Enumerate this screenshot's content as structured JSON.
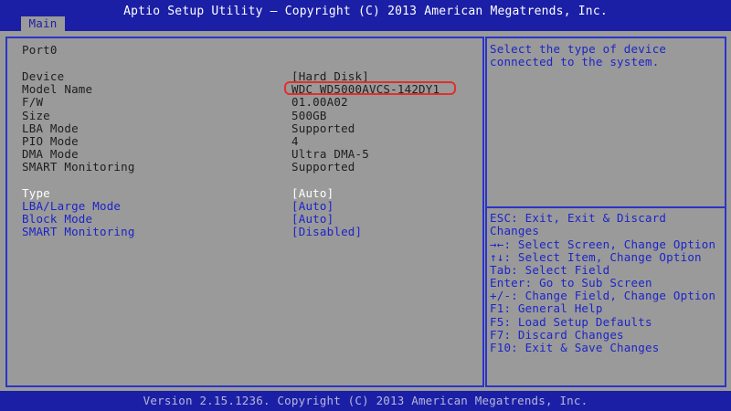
{
  "header": {
    "title": "Aptio Setup Utility – Copyright (C) 2013 American Megatrends, Inc.",
    "tab": "Main"
  },
  "main": {
    "port": "Port0",
    "info": [
      {
        "label": "Device",
        "value": "[Hard Disk]"
      },
      {
        "label": "Model Name",
        "value": "WDC WD5000AVCS-142DY1"
      },
      {
        "label": "F/W",
        "value": "01.00A02"
      },
      {
        "label": "Size",
        "value": "500GB"
      },
      {
        "label": "LBA Mode",
        "value": "Supported"
      },
      {
        "label": "PIO Mode",
        "value": "4"
      },
      {
        "label": "DMA Mode",
        "value": "Ultra DMA-5"
      },
      {
        "label": "SMART Monitoring",
        "value": "Supported"
      }
    ],
    "settings": [
      {
        "label": "Type",
        "value": "[Auto]"
      },
      {
        "label": "LBA/Large Mode",
        "value": "[Auto]"
      },
      {
        "label": "Block Mode",
        "value": "[Auto]"
      },
      {
        "label": "SMART Monitoring",
        "value": "[Disabled]"
      }
    ]
  },
  "help": {
    "description_lines": [
      "Select the type of device",
      "connected to the system."
    ],
    "keys": [
      "ESC: Exit, Exit & Discard",
      "Changes",
      "→←: Select Screen, Change Option",
      "↑↓: Select Item, Change Option",
      "Tab: Select Field",
      "Enter: Go to Sub Screen",
      "+/-: Change Field, Change Option",
      "F1: General Help",
      "F5: Load Setup Defaults",
      "F7: Discard Changes",
      "F10: Exit & Save Changes"
    ]
  },
  "footer": {
    "version": "Version 2.15.1236. Copyright (C) 2013 American Megatrends, Inc."
  },
  "colors": {
    "header_bg": "#1b1fa6",
    "panel_bg": "#9a9a9a",
    "frame_border": "#2a35c8",
    "highlight_box": "#e0302b",
    "menu_text": "#1c24c8",
    "selected_text": "#ffffff"
  }
}
